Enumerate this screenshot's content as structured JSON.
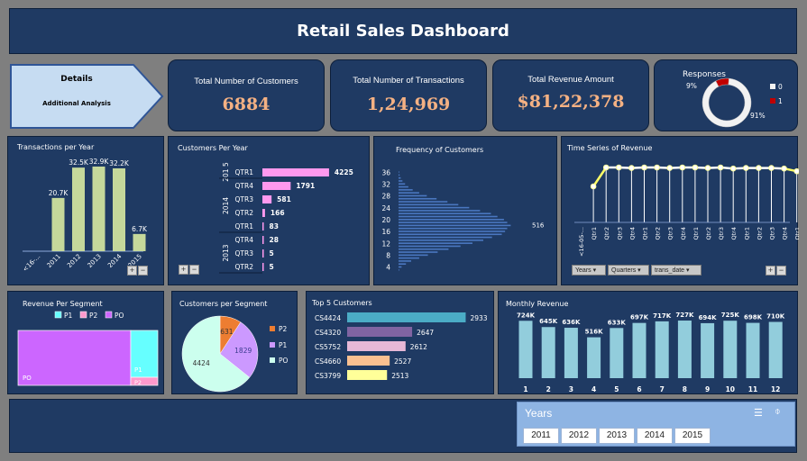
{
  "header": {
    "title": "Retail Sales Dashboard"
  },
  "details": {
    "line1": "Details",
    "line2": "Additional Analysis"
  },
  "kpis": [
    {
      "label": "Total Number of Customers",
      "value": "6884"
    },
    {
      "label": "Total Number of Transactions",
      "value": "1,24,969"
    },
    {
      "label": "Total Revenue Amount",
      "value": "$81,22,378"
    }
  ],
  "colors": {
    "panel": "#1f3a63",
    "kpi_value": "#f4b183",
    "bar_green": "#c5d89b",
    "bar_pink": "#ff99ee",
    "bar_blue": "#4a77c0",
    "bar_teal": "#92cddc",
    "line_white": "#ffffff",
    "line_yellow": "#ffff66"
  },
  "chart_data": [
    {
      "type": "pie",
      "title": "Responses",
      "categories": [
        "0",
        "1"
      ],
      "values": [
        9,
        91
      ],
      "labels": [
        "9%",
        "91%"
      ],
      "legend": [
        "0",
        "1"
      ]
    },
    {
      "type": "bar",
      "title": "Transactions per Year",
      "categories": [
        "<16-...",
        "2011",
        "2012",
        "2013",
        "2014",
        "2015"
      ],
      "values": [
        0,
        20.7,
        32.5,
        32.9,
        32.2,
        6.7
      ],
      "labels": [
        "",
        "20.7K",
        "32.5K",
        "32.9K",
        "32.2K",
        "6.7K"
      ],
      "ylim": [
        0,
        35
      ]
    },
    {
      "type": "bar",
      "title": "Customers Per Year",
      "orientation": "horizontal",
      "groups": [
        {
          "year": "2015",
          "year_display": "201 5",
          "quarters": [
            {
              "q": "QTR1",
              "value": 4225
            }
          ]
        },
        {
          "year": "2014",
          "year_display": "2014",
          "quarters": [
            {
              "q": "QTR4",
              "value": 1791
            },
            {
              "q": "QTR3",
              "value": 581
            },
            {
              "q": "QTR2",
              "value": 166
            },
            {
              "q": "QTR1",
              "value": 83
            }
          ]
        },
        {
          "year": "2013",
          "year_display": "2013",
          "quarters": [
            {
              "q": "QTR4",
              "value": 28
            },
            {
              "q": "QTR3",
              "value": 5
            },
            {
              "q": "QTR2",
              "value": 5
            }
          ]
        }
      ],
      "xlim": [
        0,
        4500
      ]
    },
    {
      "type": "bar",
      "title": "Frequency of Customers",
      "orientation": "horizontal",
      "y_ticks": [
        "36",
        "32",
        "28",
        "24",
        "20",
        "16",
        "12",
        "8",
        "4"
      ],
      "ylim": [
        3,
        37
      ],
      "xlim": [
        0,
        560
      ],
      "peak_label": "516",
      "peak_y": 18,
      "values": [
        [
          3,
          3
        ],
        [
          4,
          14
        ],
        [
          5,
          34
        ],
        [
          6,
          58
        ],
        [
          7,
          95
        ],
        [
          8,
          135
        ],
        [
          9,
          180
        ],
        [
          10,
          230
        ],
        [
          11,
          285
        ],
        [
          12,
          340
        ],
        [
          13,
          390
        ],
        [
          14,
          430
        ],
        [
          15,
          475
        ],
        [
          16,
          490
        ],
        [
          17,
          500
        ],
        [
          18,
          516
        ],
        [
          19,
          500
        ],
        [
          20,
          485
        ],
        [
          21,
          455
        ],
        [
          22,
          425
        ],
        [
          23,
          375
        ],
        [
          24,
          325
        ],
        [
          25,
          275
        ],
        [
          26,
          225
        ],
        [
          27,
          175
        ],
        [
          28,
          130
        ],
        [
          29,
          95
        ],
        [
          30,
          65
        ],
        [
          31,
          45
        ],
        [
          32,
          30
        ],
        [
          33,
          18
        ],
        [
          34,
          10
        ],
        [
          35,
          5
        ],
        [
          36,
          3
        ]
      ]
    },
    {
      "type": "line",
      "title": "Time Series of Revenue",
      "categories": [
        "<16-05-...",
        "Qtr1",
        "Qtr2",
        "Qtr3",
        "Qtr4",
        "Qtr1",
        "Qtr2",
        "Qtr3",
        "Qtr4",
        "Qtr1",
        "Qtr2",
        "Qtr3",
        "Qtr4",
        "Qtr1",
        "Qtr2",
        "Qtr3",
        "Qtr4",
        "Qtr1"
      ],
      "values": [
        null,
        0.65,
        1.0,
        1.0,
        0.99,
        1.0,
        1.0,
        0.99,
        1.0,
        1.0,
        0.99,
        1.0,
        0.98,
        0.99,
        0.99,
        0.99,
        0.98,
        0.93
      ],
      "filters": [
        "Years",
        "Quarters",
        "trans_date"
      ]
    },
    {
      "type": "heatmap",
      "title": "Revenue Per Segment",
      "legend": [
        "P1",
        "P2",
        "PO"
      ],
      "segments": [
        {
          "name": "PO",
          "color": "#cc66ff"
        },
        {
          "name": "P1",
          "color": "#66ffff"
        },
        {
          "name": "P2",
          "color": "#ff99cc"
        }
      ]
    },
    {
      "type": "pie",
      "title": "Customers per Segment",
      "categories": [
        "P2",
        "P1",
        "PO"
      ],
      "values": [
        631,
        1829,
        4424
      ],
      "legend": [
        "P2",
        "P1",
        "PO"
      ]
    },
    {
      "type": "bar",
      "title": "Top 5 Customers",
      "orientation": "horizontal",
      "categories": [
        "CS4424",
        "CS4320",
        "CS5752",
        "CS4660",
        "CS3799"
      ],
      "values": [
        2933,
        2647,
        2612,
        2527,
        2513
      ],
      "xlim": [
        2300,
        2950
      ]
    },
    {
      "type": "bar",
      "title": "Monthly Revenue",
      "categories": [
        "1",
        "2",
        "3",
        "4",
        "5",
        "6",
        "7",
        "8",
        "9",
        "10",
        "11",
        "12"
      ],
      "values": [
        724,
        645,
        636,
        516,
        633,
        697,
        717,
        727,
        694,
        725,
        698,
        710
      ],
      "labels": [
        "724K",
        "645K",
        "636K",
        "516K",
        "633K",
        "697K",
        "717K",
        "727K",
        "694K",
        "725K",
        "698K",
        "710K"
      ],
      "ylim": [
        0,
        750
      ]
    }
  ],
  "slicer": {
    "title": "Years",
    "items": [
      "2011",
      "2012",
      "2013",
      "2014",
      "2015"
    ]
  }
}
